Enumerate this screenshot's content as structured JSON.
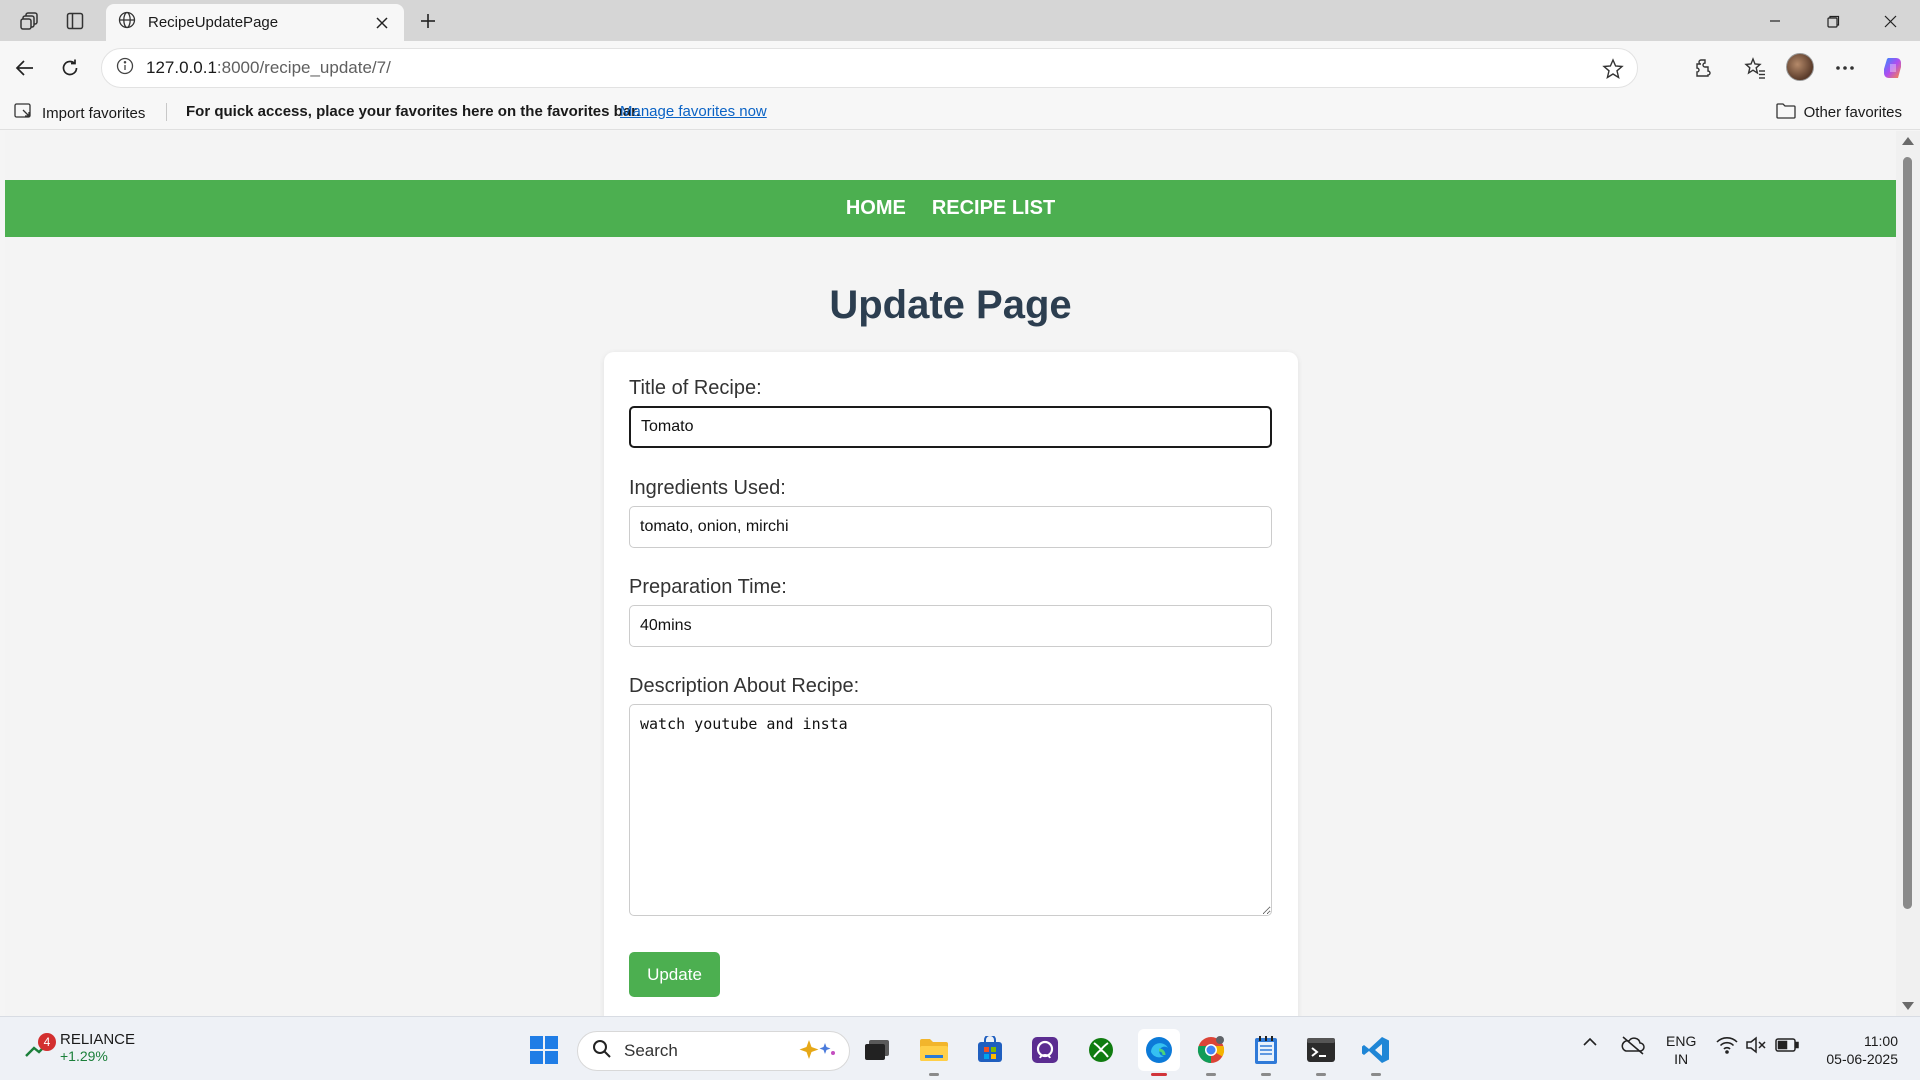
{
  "browser": {
    "tab_title": "RecipeUpdatePage",
    "url_host": "127.0.0.1",
    "url_path": ":8000/recipe_update/7/",
    "favorites_bar": {
      "import_label": "Import favorites",
      "message": "For quick access, place your favorites here on the favorites bar.",
      "manage_link": "Manage favorites now",
      "other_label": "Other favorites"
    }
  },
  "site": {
    "nav": {
      "home": "HOME",
      "recipe_list": "RECIPE LIST"
    },
    "page_title": "Update Page",
    "form": {
      "title_label": "Title of Recipe:",
      "title_value": "Tomato",
      "ingredients_label": "Ingredients Used:",
      "ingredients_value": "tomato, onion, mirchi",
      "prep_label": "Preparation Time:",
      "prep_value": "40mins",
      "description_label": "Description About Recipe:",
      "description_value": "watch youtube and insta",
      "submit_label": "Update"
    }
  },
  "taskbar": {
    "stock": {
      "badge": "4",
      "name": "RELIANCE",
      "change": "+1.29%"
    },
    "search_placeholder": "Search",
    "language": {
      "line1": "ENG",
      "line2": "IN"
    },
    "clock": {
      "time": "11:00",
      "date": "05-06-2025"
    },
    "apps": [
      "start-icon",
      "file-explorer-icon",
      "microsoft-store-icon",
      "copilot-app-icon",
      "xbox-icon",
      "edge-icon",
      "chrome-icon",
      "notepad-icon",
      "terminal-icon",
      "vscode-icon"
    ]
  },
  "colors": {
    "nav_green": "#4caf50",
    "title_navy": "#2c3e50",
    "link_blue": "#0b63c5"
  }
}
